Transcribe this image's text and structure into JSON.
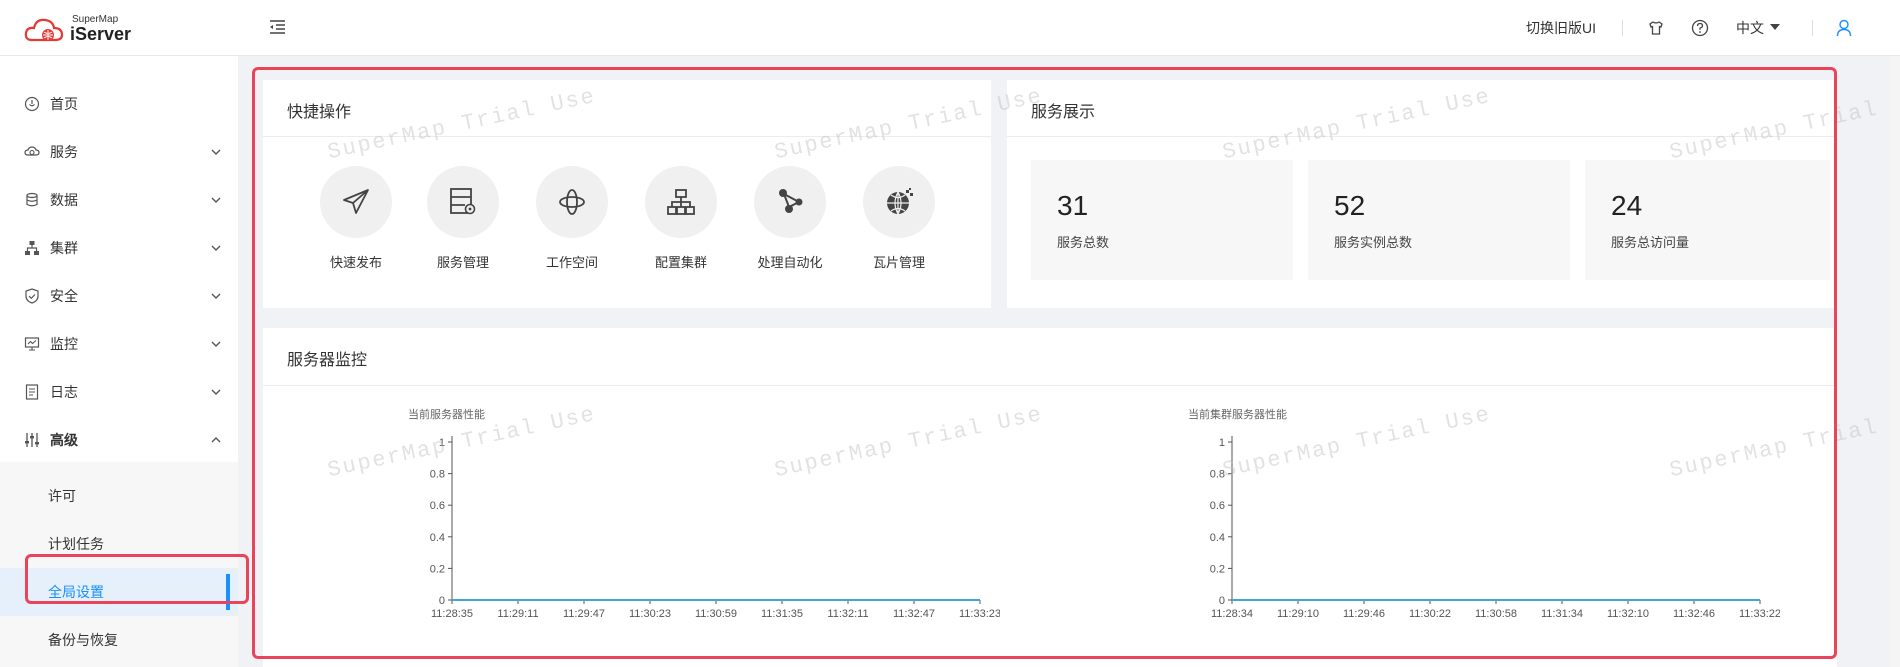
{
  "header": {
    "brand_small": "SuperMap",
    "brand_big": "iServer",
    "switch_ui": "切换旧版UI",
    "language": "中文"
  },
  "sidebar": {
    "items": [
      {
        "label": "首页",
        "icon": "home-icon"
      },
      {
        "label": "服务",
        "icon": "service-icon",
        "chevron": "down"
      },
      {
        "label": "数据",
        "icon": "database-icon",
        "chevron": "down"
      },
      {
        "label": "集群",
        "icon": "cluster-icon",
        "chevron": "down"
      },
      {
        "label": "安全",
        "icon": "shield-icon",
        "chevron": "down"
      },
      {
        "label": "监控",
        "icon": "monitor-icon",
        "chevron": "down"
      },
      {
        "label": "日志",
        "icon": "log-icon",
        "chevron": "down"
      },
      {
        "label": "高级",
        "icon": "sliders-icon",
        "chevron": "up"
      }
    ],
    "sub_items": [
      {
        "label": "许可"
      },
      {
        "label": "计划任务"
      },
      {
        "label": "全局设置",
        "active": true
      },
      {
        "label": "备份与恢复"
      }
    ]
  },
  "quick_ops": {
    "title": "快捷操作",
    "items": [
      {
        "label": "快速发布",
        "icon": "paper-plane-icon"
      },
      {
        "label": "服务管理",
        "icon": "server-gear-icon"
      },
      {
        "label": "工作空间",
        "icon": "orbit-icon"
      },
      {
        "label": "配置集群",
        "icon": "network-icon"
      },
      {
        "label": "处理自动化",
        "icon": "workflow-icon"
      },
      {
        "label": "瓦片管理",
        "icon": "globe-tiles-icon"
      }
    ]
  },
  "service_display": {
    "title": "服务展示",
    "stats": [
      {
        "value": "31",
        "label": "服务总数"
      },
      {
        "value": "52",
        "label": "服务实例总数"
      },
      {
        "value": "24",
        "label": "服务总访问量"
      }
    ]
  },
  "monitor": {
    "title": "服务器监控"
  },
  "watermark_text": "SuperMap Trial Use",
  "colors": {
    "accent": "#1890ff",
    "highlight": "#e8455c",
    "line": "#3fa6d8"
  },
  "chart_data": [
    {
      "type": "line",
      "title": "当前服务器性能",
      "x": [
        "11:28:35",
        "11:29:11",
        "11:29:47",
        "11:30:23",
        "11:30:59",
        "11:31:35",
        "11:32:11",
        "11:32:47",
        "11:33:23"
      ],
      "series": [
        {
          "values": [
            0,
            0,
            0,
            0,
            0,
            0,
            0,
            0,
            0
          ]
        }
      ],
      "ylim": [
        0,
        1
      ],
      "yticks": [
        "0",
        "0.2",
        "0.4",
        "0.6",
        "0.8",
        "1"
      ],
      "grid": false
    },
    {
      "type": "line",
      "title": "当前集群服务器性能",
      "x": [
        "11:28:34",
        "11:29:10",
        "11:29:46",
        "11:30:22",
        "11:30:58",
        "11:31:34",
        "11:32:10",
        "11:32:46",
        "11:33:22"
      ],
      "series": [
        {
          "values": [
            0,
            0,
            0,
            0,
            0,
            0,
            0,
            0,
            0
          ]
        }
      ],
      "ylim": [
        0,
        1
      ],
      "yticks": [
        "0",
        "0.2",
        "0.4",
        "0.6",
        "0.8",
        "1"
      ],
      "grid": false
    }
  ]
}
